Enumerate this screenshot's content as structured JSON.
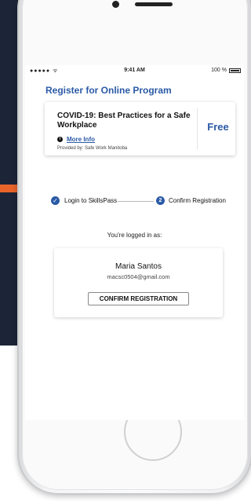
{
  "status_bar": {
    "signal": "●●●●● ᯤ",
    "time": "9:41 AM",
    "battery_text": "100 %"
  },
  "page": {
    "title": "Register for Online Program"
  },
  "course_card": {
    "title": "COVID-19: Best Practices for a Safe Workplace",
    "info_icon": "i",
    "more_info_link": "More Info",
    "provider": "Provided by: Safe Work Manitoba",
    "price": "Free"
  },
  "steps": [
    {
      "icon": "✓",
      "label": "Login to SkillsPass"
    },
    {
      "number": "2",
      "label": "Confirm Registration"
    }
  ],
  "account": {
    "logged_in_label": "You're logged in as:",
    "name": "Maria Santos",
    "email": "macsc0504@gmail.com",
    "confirm_button": "CONFIRM REGISTRATION"
  },
  "colors": {
    "accent": "#2b5aa6",
    "background_navy": "#1c2537",
    "background_orange": "#e8642b"
  }
}
